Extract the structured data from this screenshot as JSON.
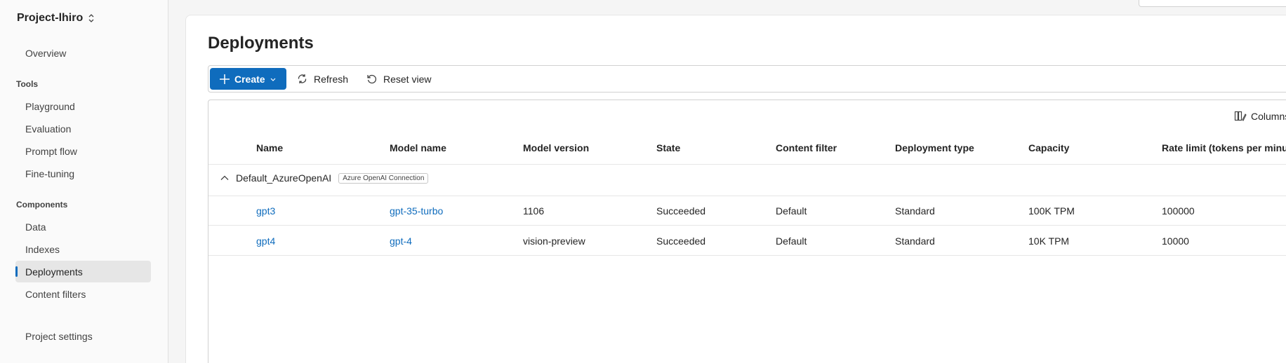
{
  "sidebar": {
    "project": "Project-lhiro",
    "overview": "Overview",
    "sections": {
      "tools": "Tools",
      "components": "Components"
    },
    "tools": [
      "Playground",
      "Evaluation",
      "Prompt flow",
      "Fine-tuning"
    ],
    "components": [
      "Data",
      "Indexes",
      "Deployments",
      "Content filters"
    ],
    "active": "Deployments",
    "project_settings": "Project settings"
  },
  "main": {
    "title": "Deployments",
    "toolbar": {
      "create": "Create",
      "refresh": "Refresh",
      "reset_view": "Reset view"
    },
    "columns_button": "Columns",
    "table": {
      "headers": [
        "Name",
        "Model name",
        "Model version",
        "State",
        "Content filter",
        "Deployment type",
        "Capacity",
        "Rate limit (tokens per minute)"
      ],
      "group": {
        "name": "Default_AzureOpenAI",
        "badge": "Azure OpenAI Connection"
      },
      "rows": [
        {
          "name": "gpt3",
          "model_name": "gpt-35-turbo",
          "model_version": "1106",
          "state": "Succeeded",
          "content_filter": "Default",
          "deployment_type": "Standard",
          "capacity": "100K TPM",
          "rate_limit": "100000"
        },
        {
          "name": "gpt4",
          "model_name": "gpt-4",
          "model_version": "vision-preview",
          "state": "Succeeded",
          "content_filter": "Default",
          "deployment_type": "Standard",
          "capacity": "10K TPM",
          "rate_limit": "10000"
        }
      ]
    }
  },
  "colors": {
    "accent": "#0f6cbd",
    "active_nav_bg": "#e6e6e6"
  }
}
